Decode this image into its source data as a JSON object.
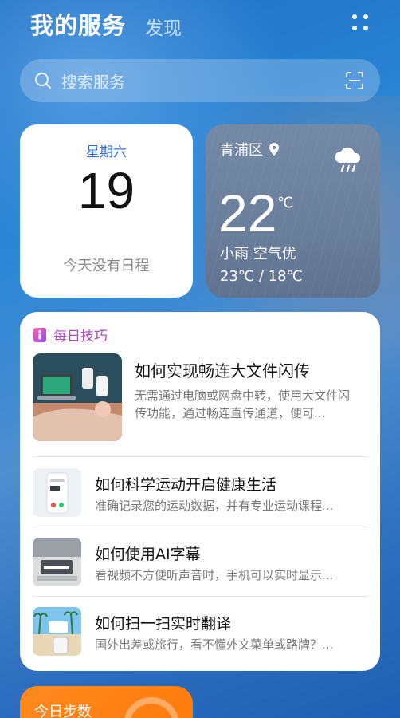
{
  "header": {
    "title": "我的服务",
    "tab_discover": "发现"
  },
  "search": {
    "placeholder": "搜索服务"
  },
  "date_card": {
    "weekday": "星期六",
    "day": "19",
    "schedule": "今天没有日程"
  },
  "weather": {
    "location": "青浦区",
    "temperature": "22",
    "unit": "℃",
    "description": "小雨 空气优",
    "range": "23℃ / 18℃"
  },
  "tips": {
    "header": "每日技巧",
    "featured": {
      "title": "如何实现畅连大文件闪传",
      "subtitle": "无需通过电脑或网盘中转，使用大文件闪传功能，通过畅连直传通道，便可..."
    },
    "items": [
      {
        "title": "如何科学运动开启健康生活",
        "subtitle": "准确记录您的运动数据，并有专业运动课程..."
      },
      {
        "title": "如何使用AI字幕",
        "subtitle": "看视频不方便听声音时，手机可以实时显示..."
      },
      {
        "title": "如何扫一扫实时翻译",
        "subtitle": "国外出差或旅行，看不懂外文菜单或路牌？..."
      }
    ]
  },
  "steps": {
    "label": "今日步数"
  },
  "colors": {
    "weekday": "#2d6fd6",
    "tips_accent": "#b447c8",
    "steps_orange": "#ff8a1f"
  }
}
